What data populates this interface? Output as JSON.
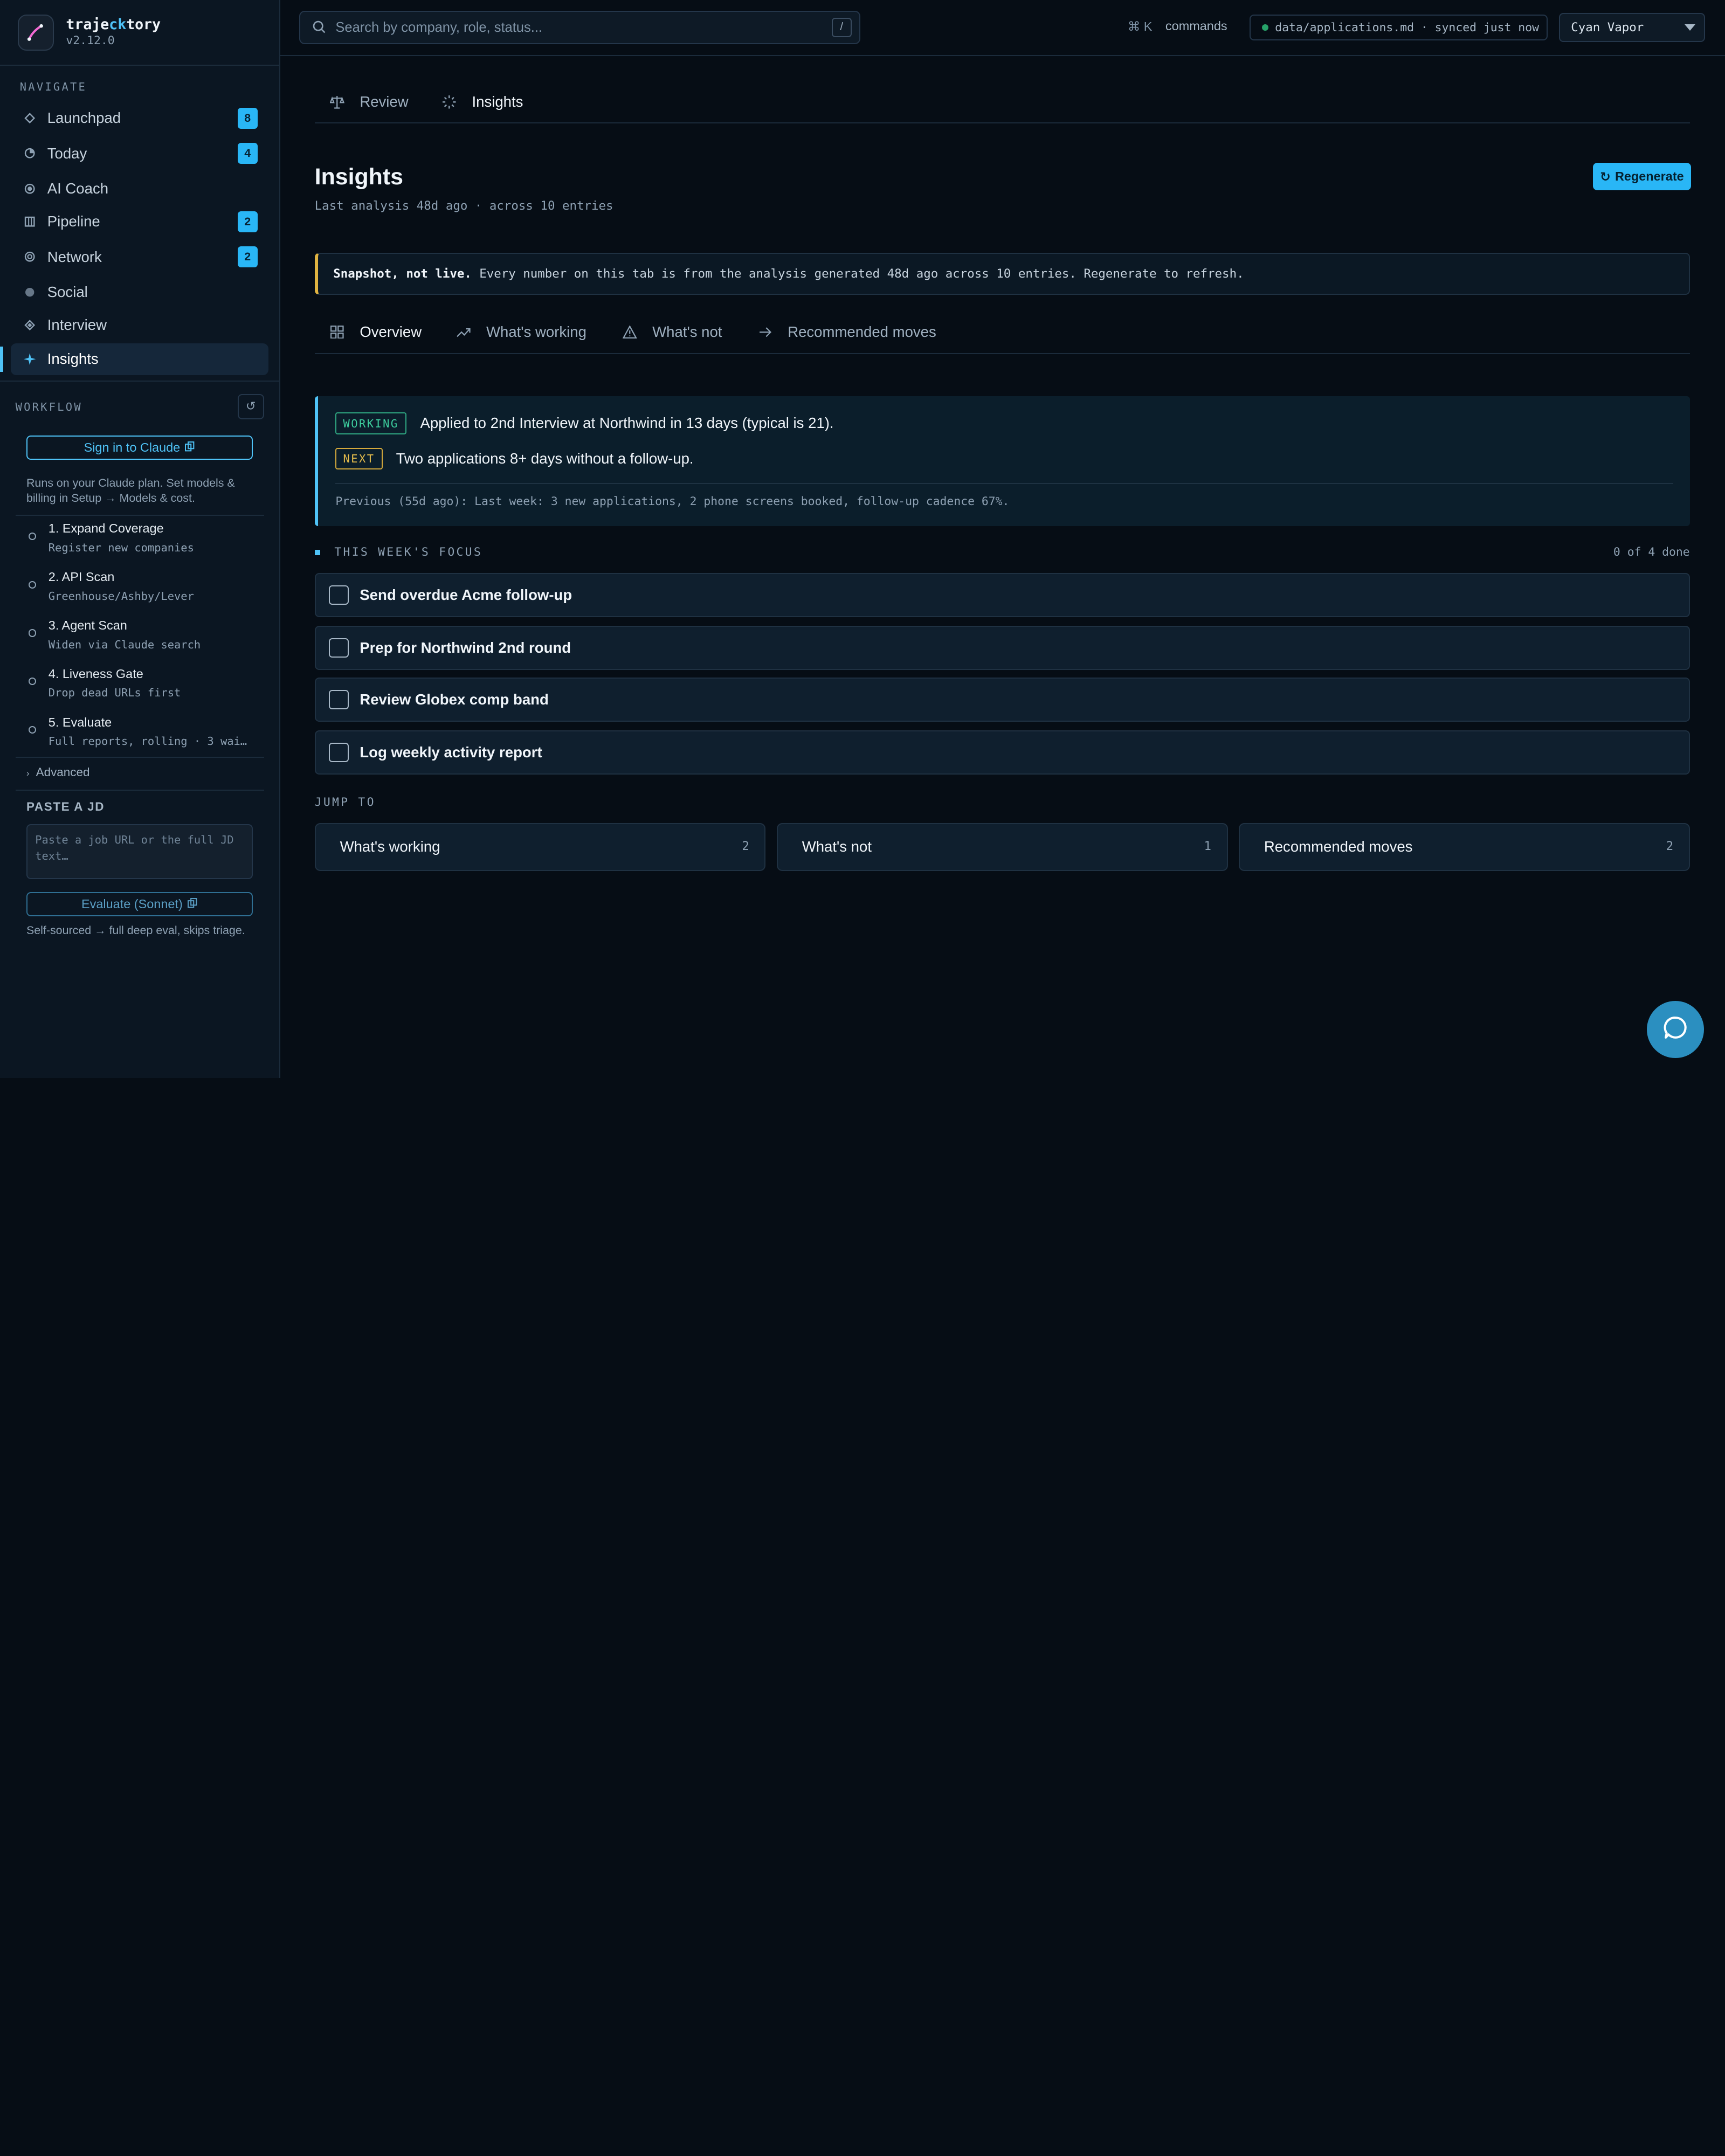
{
  "brand": {
    "name_pre": "traje",
    "name_accent": "ck",
    "name_post": "tory",
    "version": "v2.12.0"
  },
  "sidebar": {
    "navigate_label": "NAVIGATE",
    "nav": [
      {
        "label": "Launchpad",
        "badge": "8"
      },
      {
        "label": "Today",
        "badge": "4"
      },
      {
        "label": "AI Coach",
        "badge": ""
      },
      {
        "label": "Pipeline",
        "badge": "2"
      },
      {
        "label": "Network",
        "badge": "2"
      },
      {
        "label": "Social",
        "badge": ""
      },
      {
        "label": "Interview",
        "badge": ""
      },
      {
        "label": "Insights",
        "badge": ""
      }
    ],
    "workflow_label": "WORKFLOW",
    "sign_in_label": "Sign in to Claude",
    "plan_note": "Runs on your Claude plan. Set models & billing in Setup → Models & cost.",
    "steps": [
      {
        "title": "1. Expand Coverage",
        "sub": "Register new companies"
      },
      {
        "title": "2. API Scan",
        "sub": "Greenhouse/Ashby/Lever"
      },
      {
        "title": "3. Agent Scan",
        "sub": "Widen via Claude search"
      },
      {
        "title": "4. Liveness Gate",
        "sub": "Drop dead URLs first"
      },
      {
        "title": "5. Evaluate",
        "sub": "Full reports, rolling · 3 wai…"
      }
    ],
    "advanced_label": "Advanced",
    "paste_label": "PASTE A JD",
    "paste_placeholder": "Paste a job URL or the full JD text…",
    "evaluate_label": "Evaluate (Sonnet)",
    "evaluate_note": "Self-sourced → full deep eval, skips triage."
  },
  "topbar": {
    "search_placeholder": "Search by company, role, status...",
    "search_key": "/",
    "cmd_key": "⌘ K",
    "cmd_label": "commands",
    "file": "data/applications.md · synced just now",
    "theme": "Cyan Vapor"
  },
  "main": {
    "top_tabs": [
      {
        "label": "Review"
      },
      {
        "label": "Insights"
      }
    ],
    "title": "Insights",
    "subtitle": "Last analysis 48d ago · across 10 entries",
    "regenerate_label": "Regenerate",
    "snapshot_bold": "Snapshot, not live.",
    "snapshot_text": "Every number on this tab is from the analysis generated 48d ago across 10 entries. Regenerate to refresh.",
    "sub_tabs": [
      {
        "label": "Overview"
      },
      {
        "label": "What's working"
      },
      {
        "label": "What's not"
      },
      {
        "label": "Recommended moves"
      }
    ],
    "summary": {
      "working_tag": "WORKING",
      "working_text": "Applied to 2nd Interview at Northwind in 13 days (typical is 21).",
      "next_tag": "NEXT",
      "next_text": "Two applications 8+ days without a follow-up.",
      "previous": "Previous (55d ago): Last week: 3 new applications, 2 phone screens booked, follow-up cadence 67%."
    },
    "focus_label": "THIS WEEK'S FOCUS",
    "focus_count": "0 of 4 done",
    "tasks": [
      {
        "label": "Send overdue Acme follow-up"
      },
      {
        "label": "Prep for Northwind 2nd round"
      },
      {
        "label": "Review Globex comp band"
      },
      {
        "label": "Log weekly activity report"
      }
    ],
    "jump_label": "JUMP TO",
    "jump": [
      {
        "label": "What's working",
        "count": "2"
      },
      {
        "label": "What's not",
        "count": "1"
      },
      {
        "label": "Recommended moves",
        "count": "2"
      }
    ]
  },
  "colors": {
    "accent": "#4fc3f7",
    "working": "#3ed1a0",
    "next": "#e6bd4c",
    "snapshot_border": "#e0b341"
  }
}
